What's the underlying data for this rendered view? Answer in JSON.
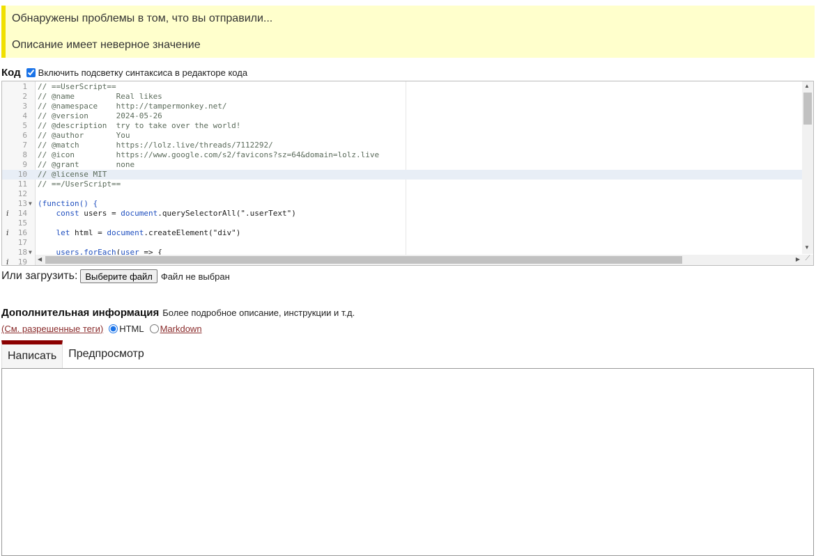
{
  "alert": {
    "line1": "Обнаружены проблемы в том, что вы отправили...",
    "line2": "Описание имеет неверное значение"
  },
  "code": {
    "label": "Код",
    "highlight_label": "Включить подсветку синтаксиса в редакторе кода",
    "highlight_checked": true,
    "active_line": 10,
    "lines": [
      {
        "n": "1",
        "text": "// ==UserScript==",
        "kind": "comment"
      },
      {
        "n": "2",
        "text": "// @name         Real likes",
        "kind": "comment"
      },
      {
        "n": "3",
        "text": "// @namespace    http://tampermonkey.net/",
        "kind": "comment"
      },
      {
        "n": "4",
        "text": "// @version      2024-05-26",
        "kind": "comment"
      },
      {
        "n": "5",
        "text": "// @description  try to take over the world!",
        "kind": "comment"
      },
      {
        "n": "6",
        "text": "// @author       You",
        "kind": "comment"
      },
      {
        "n": "7",
        "text": "// @match        https://lolz.live/threads/7112292/",
        "kind": "comment"
      },
      {
        "n": "8",
        "text": "// @icon         https://www.google.com/s2/favicons?sz=64&domain=lolz.live",
        "kind": "comment"
      },
      {
        "n": "9",
        "text": "// @grant        none",
        "kind": "comment"
      },
      {
        "n": "10",
        "text": "// @license MIT",
        "kind": "comment"
      },
      {
        "n": "11",
        "text": "// ==/UserScript==",
        "kind": "comment"
      },
      {
        "n": "12",
        "text": "",
        "kind": "code"
      },
      {
        "n": "13",
        "text": "(function() {",
        "kind": "fn",
        "fold": true
      },
      {
        "n": "14",
        "text": "    const users = document.querySelectorAll(\".userText\")",
        "kind": "code",
        "info": true
      },
      {
        "n": "15",
        "text": "",
        "kind": "code"
      },
      {
        "n": "16",
        "text": "    let html = document.createElement(\"div\")",
        "kind": "code",
        "info": true
      },
      {
        "n": "17",
        "text": "",
        "kind": "code"
      },
      {
        "n": "18",
        "text": "    users.forEach(user => {",
        "kind": "code",
        "fold": true
      },
      {
        "n": "19",
        "text": "",
        "kind": "code",
        "info": true
      }
    ]
  },
  "upload": {
    "label": "Или загрузить:",
    "button": "Выберите файл",
    "status": "Файл не выбран"
  },
  "additional": {
    "title": "Дополнительная информация",
    "description": "Более подробное описание, инструкции и т.д.",
    "allowed_tags": "(См. разрешенные теги)",
    "format_html": "HTML",
    "format_markdown": "Markdown",
    "selected_format": "HTML"
  },
  "tabs": [
    {
      "label": "Написать",
      "active": true
    },
    {
      "label": "Предпросмотр",
      "active": false
    }
  ],
  "colors": {
    "alert_bg": "#ffffcc",
    "alert_border": "#f0e000",
    "tab_accent": "#8b0000",
    "link": "#8a2b2b"
  }
}
